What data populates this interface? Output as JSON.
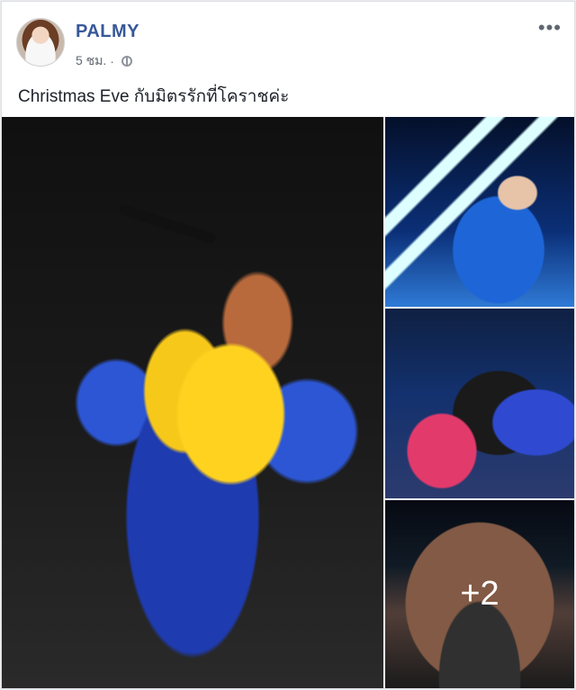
{
  "post": {
    "author": "PALMY",
    "time": "5 ชม.",
    "caption": "Christmas Eve กับมิตรรักที่โคราชค่ะ",
    "more_menu": "•••",
    "extra_photos_label": "+2"
  },
  "icons": {
    "privacy": "globe-icon",
    "menu": "ellipsis-icon",
    "avatar": "profile-avatar"
  },
  "colors": {
    "author_name": "#385898",
    "meta_text": "#616770"
  }
}
